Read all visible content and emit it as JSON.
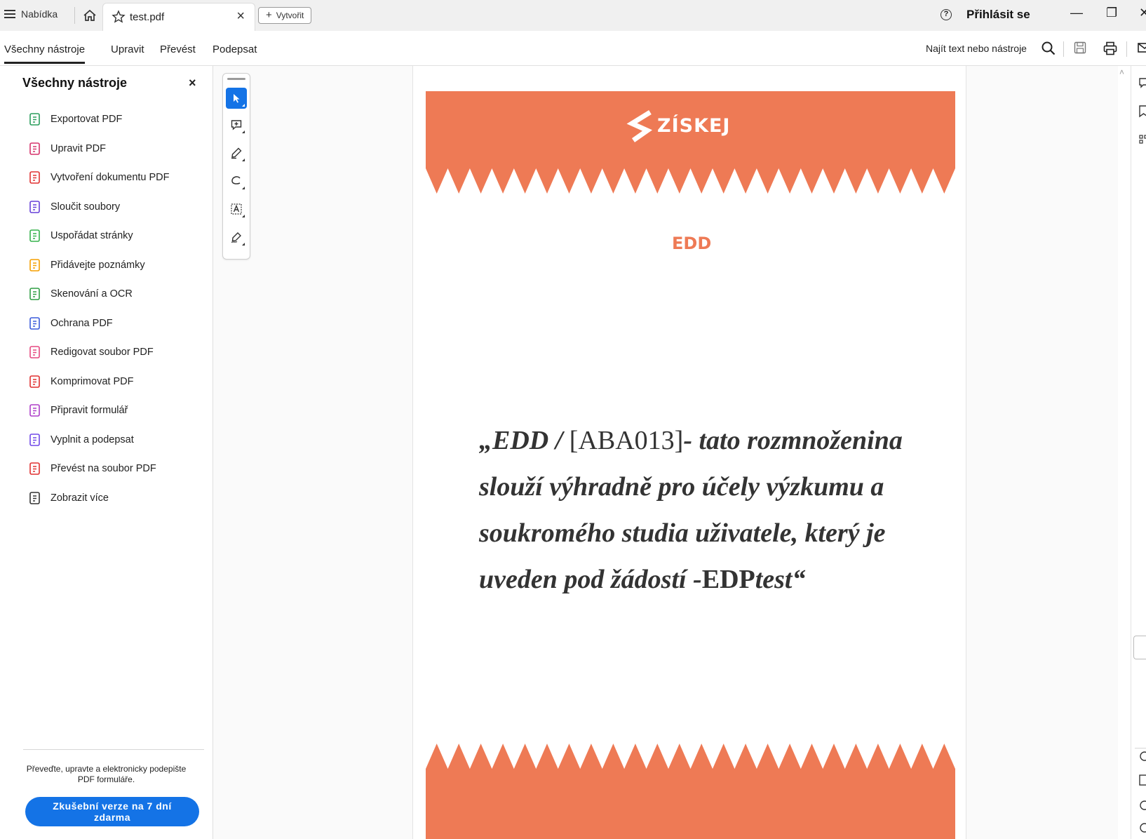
{
  "titlebar": {
    "menu_label": "Nabídka",
    "tab_title": "test.pdf",
    "tab_close": "×",
    "create_label": "Vytvořit",
    "help_symbol": "?",
    "signin_label": "Přihlásit se",
    "minimize": "—",
    "maximize": "❐",
    "close": "✕"
  },
  "toolbar": {
    "nav": [
      "Všechny nástroje",
      "Upravit",
      "Převést",
      "Podepsat"
    ],
    "active_index": 0,
    "find_label": "Najít text nebo nástroje"
  },
  "left_panel": {
    "title": "Všechny nástroje",
    "close": "×",
    "items": [
      {
        "label": "Exportovat PDF",
        "icon": "export-pdf-icon",
        "color": "#2a9d5c"
      },
      {
        "label": "Upravit PDF",
        "icon": "edit-pdf-icon",
        "color": "#d6336c"
      },
      {
        "label": "Vytvoření dokumentu PDF",
        "icon": "create-pdf-icon",
        "color": "#e03131"
      },
      {
        "label": "Sloučit soubory",
        "icon": "combine-files-icon",
        "color": "#6741d9"
      },
      {
        "label": "Uspořádat stránky",
        "icon": "organize-pages-icon",
        "color": "#37b24d"
      },
      {
        "label": "Přidávejte poznámky",
        "icon": "comment-icon",
        "color": "#f59f00"
      },
      {
        "label": "Skenování a OCR",
        "icon": "scan-ocr-icon",
        "color": "#2f9e44"
      },
      {
        "label": "Ochrana PDF",
        "icon": "protect-pdf-icon",
        "color": "#3b5bdb"
      },
      {
        "label": "Redigovat soubor PDF",
        "icon": "redact-icon",
        "color": "#e64980"
      },
      {
        "label": "Komprimovat PDF",
        "icon": "compress-pdf-icon",
        "color": "#e03131"
      },
      {
        "label": "Připravit formulář",
        "icon": "prepare-form-icon",
        "color": "#ae3ec9"
      },
      {
        "label": "Vyplnit a podepsat",
        "icon": "fill-sign-icon",
        "color": "#7048e8"
      },
      {
        "label": "Převést na soubor PDF",
        "icon": "convert-pdf-icon",
        "color": "#e03131"
      },
      {
        "label": "Zobrazit více",
        "icon": "tools-more-icon",
        "color": "#333333"
      }
    ],
    "promo_line1": "Převeďte, upravte a elektronicky podepište",
    "promo_line2": "PDF formuláře.",
    "trial_line1": "Zkušební verze na 7 dní",
    "trial_line2": "zdarma"
  },
  "palette": {
    "tools": [
      "select-arrow-icon",
      "add-comment-icon",
      "highlight-pen-icon",
      "draw-freeform-icon",
      "text-select-icon",
      "sign-pen-icon"
    ],
    "selected_index": 0
  },
  "document": {
    "logo_text": "ZÍSKEJ",
    "heading": "EDD",
    "quote_l1_a": "„EDD / ",
    "quote_l1_b": "[ABA013]",
    "quote_l1_c": "- tato rozmnoženina",
    "quote_l2": "slouží výhradně pro účely výzkumu a",
    "quote_l3": "soukromého studia uživatele, který je",
    "quote_l4_a": "uveden pod žádostí -",
    "quote_l4_b": "EDP",
    "quote_l4_c": "test“",
    "accent_color": "#ee7a55"
  }
}
